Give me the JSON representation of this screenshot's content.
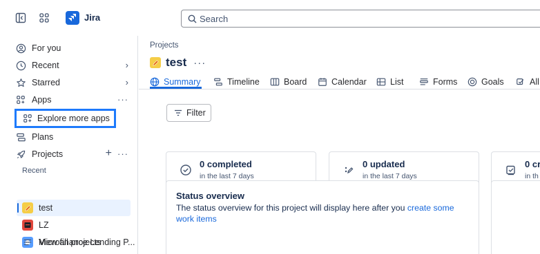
{
  "app": {
    "name": "Jira"
  },
  "search": {
    "placeholder": "Search"
  },
  "sidebar": {
    "for_you": "For you",
    "recent": "Recent",
    "starred": "Starred",
    "apps": "Apps",
    "explore_more_apps": "Explore more apps",
    "plans": "Plans",
    "projects": "Projects",
    "recent_label": "Recent",
    "projects_list": [
      {
        "name": "test",
        "icon_color": "#f5cd47"
      },
      {
        "name": "LZ",
        "icon_color": "#e2483d"
      },
      {
        "name": "Microfinance Lending P...",
        "icon_color": "#579dff"
      }
    ],
    "view_all_projects": "View all projects"
  },
  "main": {
    "breadcrumb": "Projects",
    "project_title": "test",
    "more": "···",
    "tabs": [
      {
        "label": "Summary",
        "active": true
      },
      {
        "label": "Timeline"
      },
      {
        "label": "Board"
      },
      {
        "label": "Calendar"
      },
      {
        "label": "List"
      },
      {
        "label": "Forms"
      },
      {
        "label": "Goals"
      },
      {
        "label": "All"
      }
    ],
    "filter_label": "Filter",
    "stats": [
      {
        "title": "0 completed",
        "subtitle": "in the last 7 days"
      },
      {
        "title": "0 updated",
        "subtitle": "in the last 7 days"
      },
      {
        "title": "0 cr",
        "subtitle": "in th"
      }
    ],
    "status_overview": {
      "title": "Status overview",
      "text": "The status overview for this project will display here after you ",
      "link": "create some work items"
    }
  },
  "colors": {
    "accent": "#1868db",
    "highlight": "#1d7afc",
    "selected_bg": "#e9f2ff"
  }
}
